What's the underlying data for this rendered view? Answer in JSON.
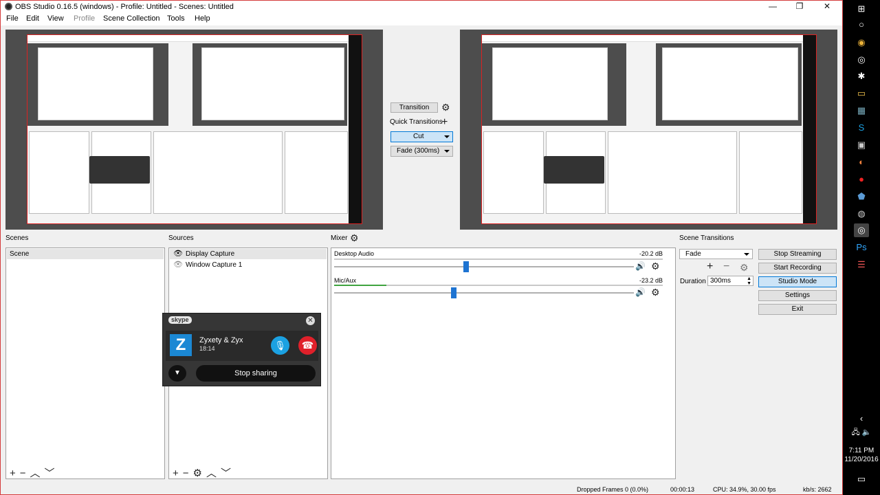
{
  "window": {
    "title": "OBS Studio 0.16.5 (windows) - Profile: Untitled - Scenes: Untitled",
    "minimize": "—",
    "maximize": "❐",
    "close": "✕"
  },
  "menu": {
    "items": [
      "File",
      "Edit",
      "View",
      "Profile",
      "Scene Collection",
      "Tools",
      "Help"
    ]
  },
  "transitions_center": {
    "transition_label": "Transition",
    "quick_transitions_label": "Quick Transitions",
    "cut_label": "Cut",
    "fade_label": "Fade (300ms)"
  },
  "scenes": {
    "title": "Scenes",
    "items": [
      "Scene"
    ]
  },
  "sources": {
    "title": "Sources",
    "items": [
      "Display Capture",
      "Window Capture 1"
    ]
  },
  "mixer": {
    "title": "Mixer",
    "channels": [
      {
        "name": "Desktop Audio",
        "db": "-20.2 dB",
        "level": 0.0,
        "volume": 0.44
      },
      {
        "name": "Mic/Aux",
        "db": "-23.2 dB",
        "level": 0.16,
        "volume": 0.4
      }
    ]
  },
  "scene_transitions": {
    "title": "Scene Transitions",
    "selected": "Fade",
    "duration_label": "Duration",
    "duration_value": "300ms"
  },
  "controls": {
    "stop_streaming": "Stop Streaming",
    "start_recording": "Start Recording",
    "studio_mode": "Studio Mode",
    "settings": "Settings",
    "exit": "Exit"
  },
  "skype": {
    "logo": "skype",
    "contact": "Zyxety & Zyx",
    "duration": "18:14",
    "avatar_letter": "Z",
    "stop_sharing": "Stop sharing"
  },
  "status": {
    "dropped_frames": "Dropped Frames 0 (0.0%)",
    "time": "00:00:13",
    "cpu": "CPU: 34.9%, 30.00 fps",
    "kbs": "kb/s: 2662"
  },
  "taskbar": {
    "time": "7:11 PM",
    "date": "11/20/2016"
  },
  "colors": {
    "accent_red": "#d43b3b",
    "active_blue": "#0078d7",
    "skype_blue": "#1ba1e2",
    "hangup_red": "#e0202a"
  }
}
